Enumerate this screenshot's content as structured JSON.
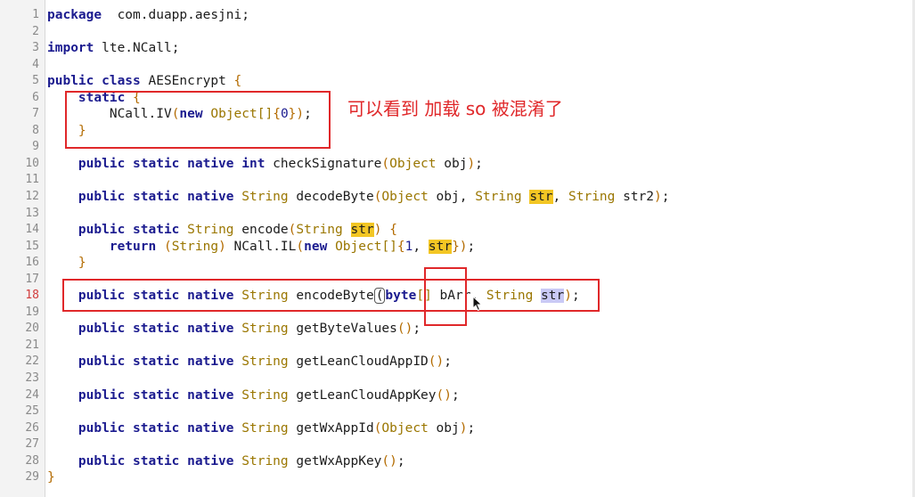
{
  "editor": {
    "active_line": "18",
    "annotation": "可以看到 加载 so 被混淆了",
    "colors": {
      "highlight_boxes": "#e0282a",
      "keyword": "#1b1b8f",
      "type": "#9a7600",
      "search_highlight": "#f3c624"
    }
  },
  "lines": [
    {
      "n": "1",
      "tokens": [
        [
          "kw",
          "package"
        ],
        [
          "",
          "  com.duapp.aesjni;"
        ]
      ]
    },
    {
      "n": "2",
      "tokens": []
    },
    {
      "n": "3",
      "tokens": [
        [
          "kw",
          "import"
        ],
        [
          "",
          " lte.NCall;"
        ]
      ]
    },
    {
      "n": "4",
      "tokens": []
    },
    {
      "n": "5",
      "tokens": [
        [
          "kw",
          "public class"
        ],
        [
          "",
          " AESEncrypt "
        ],
        [
          "p",
          "{"
        ]
      ]
    },
    {
      "n": "6",
      "tokens": [
        [
          "",
          "    "
        ],
        [
          "kw",
          "static"
        ],
        [
          "",
          " "
        ],
        [
          "p",
          "{"
        ]
      ]
    },
    {
      "n": "7",
      "tokens": [
        [
          "",
          "        NCall.IV"
        ],
        [
          "p",
          "("
        ],
        [
          "kw",
          "new"
        ],
        [
          "",
          " "
        ],
        [
          "ty",
          "Object[]"
        ],
        [
          "p",
          "{"
        ],
        [
          "num",
          "0"
        ],
        [
          "p",
          "}"
        ],
        [
          "p",
          ")"
        ],
        [
          "",
          ";"
        ]
      ]
    },
    {
      "n": "8",
      "tokens": [
        [
          "",
          "    "
        ],
        [
          "p",
          "}"
        ]
      ]
    },
    {
      "n": "9",
      "tokens": []
    },
    {
      "n": "10",
      "tokens": [
        [
          "",
          "    "
        ],
        [
          "kw",
          "public static native int"
        ],
        [
          "",
          " checkSignature"
        ],
        [
          "p",
          "("
        ],
        [
          "ty",
          "Object"
        ],
        [
          "",
          " obj"
        ],
        [
          "p",
          ")"
        ],
        [
          "",
          ";"
        ]
      ]
    },
    {
      "n": "11",
      "tokens": []
    },
    {
      "n": "12",
      "tokens": [
        [
          "",
          "    "
        ],
        [
          "kw",
          "public static native"
        ],
        [
          "",
          " "
        ],
        [
          "ty",
          "String"
        ],
        [
          "",
          " decodeByte"
        ],
        [
          "p",
          "("
        ],
        [
          "ty",
          "Object"
        ],
        [
          "",
          " obj, "
        ],
        [
          "ty",
          "String"
        ],
        [
          "",
          " "
        ],
        [
          "hl",
          "str"
        ],
        [
          "",
          ", "
        ],
        [
          "ty",
          "String"
        ],
        [
          "",
          " str2"
        ],
        [
          "p",
          ")"
        ],
        [
          "",
          ";"
        ]
      ]
    },
    {
      "n": "13",
      "tokens": []
    },
    {
      "n": "14",
      "tokens": [
        [
          "",
          "    "
        ],
        [
          "kw",
          "public static"
        ],
        [
          "",
          " "
        ],
        [
          "ty",
          "String"
        ],
        [
          "",
          " encode"
        ],
        [
          "p",
          "("
        ],
        [
          "ty",
          "String"
        ],
        [
          "",
          " "
        ],
        [
          "hl",
          "str"
        ],
        [
          "p",
          ")"
        ],
        [
          "",
          " "
        ],
        [
          "p",
          "{"
        ]
      ]
    },
    {
      "n": "15",
      "tokens": [
        [
          "",
          "        "
        ],
        [
          "kw",
          "return"
        ],
        [
          "",
          " "
        ],
        [
          "p",
          "("
        ],
        [
          "ty",
          "String"
        ],
        [
          "p",
          ")"
        ],
        [
          "",
          " NCall.IL"
        ],
        [
          "p",
          "("
        ],
        [
          "kw",
          "new"
        ],
        [
          "",
          " "
        ],
        [
          "ty",
          "Object[]"
        ],
        [
          "p",
          "{"
        ],
        [
          "num",
          "1"
        ],
        [
          "",
          ", "
        ],
        [
          "hl",
          "str"
        ],
        [
          "p",
          "}"
        ],
        [
          "p",
          ")"
        ],
        [
          "",
          ";"
        ]
      ]
    },
    {
      "n": "16",
      "tokens": [
        [
          "",
          "    "
        ],
        [
          "p",
          "}"
        ]
      ]
    },
    {
      "n": "17",
      "tokens": []
    },
    {
      "n": "18",
      "tokens": [
        [
          "",
          "    "
        ],
        [
          "kw",
          "public static native"
        ],
        [
          "",
          " "
        ],
        [
          "ty",
          "String"
        ],
        [
          "",
          " encodeByte"
        ],
        [
          "ib",
          "("
        ],
        [
          "kw",
          "byte"
        ],
        [
          "ty",
          "[]"
        ],
        [
          "",
          " bArr, "
        ],
        [
          "ty",
          "String"
        ],
        [
          "",
          " "
        ],
        [
          "hlb",
          "str"
        ],
        [
          "p",
          ")"
        ],
        [
          "",
          ";"
        ]
      ]
    },
    {
      "n": "19",
      "tokens": []
    },
    {
      "n": "20",
      "tokens": [
        [
          "",
          "    "
        ],
        [
          "kw",
          "public static native"
        ],
        [
          "",
          " "
        ],
        [
          "ty",
          "String"
        ],
        [
          "",
          " getByteValues"
        ],
        [
          "p",
          "()"
        ],
        [
          "",
          ";"
        ]
      ]
    },
    {
      "n": "21",
      "tokens": []
    },
    {
      "n": "22",
      "tokens": [
        [
          "",
          "    "
        ],
        [
          "kw",
          "public static native"
        ],
        [
          "",
          " "
        ],
        [
          "ty",
          "String"
        ],
        [
          "",
          " getLeanCloudAppID"
        ],
        [
          "p",
          "()"
        ],
        [
          "",
          ";"
        ]
      ]
    },
    {
      "n": "23",
      "tokens": []
    },
    {
      "n": "24",
      "tokens": [
        [
          "",
          "    "
        ],
        [
          "kw",
          "public static native"
        ],
        [
          "",
          " "
        ],
        [
          "ty",
          "String"
        ],
        [
          "",
          " getLeanCloudAppKey"
        ],
        [
          "p",
          "()"
        ],
        [
          "",
          ";"
        ]
      ]
    },
    {
      "n": "25",
      "tokens": []
    },
    {
      "n": "26",
      "tokens": [
        [
          "",
          "    "
        ],
        [
          "kw",
          "public static native"
        ],
        [
          "",
          " "
        ],
        [
          "ty",
          "String"
        ],
        [
          "",
          " getWxAppId"
        ],
        [
          "p",
          "("
        ],
        [
          "ty",
          "Object"
        ],
        [
          "",
          " obj"
        ],
        [
          "p",
          ")"
        ],
        [
          "",
          ";"
        ]
      ]
    },
    {
      "n": "27",
      "tokens": []
    },
    {
      "n": "28",
      "tokens": [
        [
          "",
          "    "
        ],
        [
          "kw",
          "public static native"
        ],
        [
          "",
          " "
        ],
        [
          "ty",
          "String"
        ],
        [
          "",
          " getWxAppKey"
        ],
        [
          "p",
          "()"
        ],
        [
          "",
          ";"
        ]
      ]
    },
    {
      "n": "29",
      "tokens": [
        [
          "p",
          "}"
        ]
      ]
    }
  ]
}
